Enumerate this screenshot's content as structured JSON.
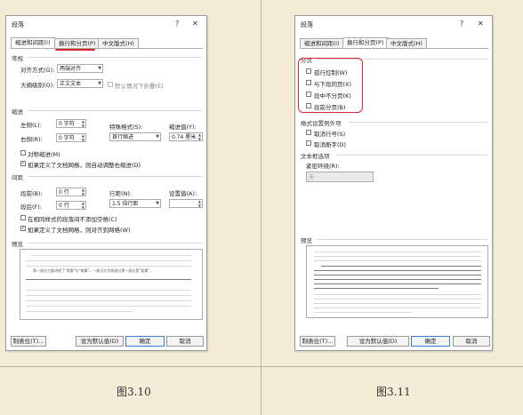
{
  "dialog_left": {
    "title": "段落",
    "help_glyph": "?",
    "close_glyph": "✕",
    "tabs": [
      "缩进和间距(I)",
      "换行和分页(P)",
      "中文版式(H)"
    ],
    "general": {
      "heading": "常规",
      "alignment_label": "对齐方式(G):",
      "alignment_value": "两端对齐",
      "outline_label": "大纲级别(O):",
      "outline_value": "正文文本",
      "collapse_label": "默认情况下折叠(E)"
    },
    "indent": {
      "heading": "缩进",
      "left_label": "左侧(L):",
      "left_value": "0 字符",
      "right_label": "右侧(R):",
      "right_value": "0 字符",
      "special_label": "特殊格式(S):",
      "special_value": "首行缩进",
      "by_label": "缩进值(Y):",
      "by_value": "0.74 厘米",
      "mirror_label": "对称缩进(M)",
      "auto_adjust_label": "如果定义了文档网格，则自动调整右缩进(D)"
    },
    "spacing": {
      "heading": "间距",
      "before_label": "段前(B):",
      "before_value": "0 行",
      "after_label": "段后(F):",
      "after_value": "0 行",
      "line_label": "行距(N):",
      "line_value": "1.5 倍行距",
      "at_label": "设置值(A):",
      "no_space_label": "在相同样式的段落间不添加空格(C)",
      "snap_label": "如果定义了文档网格，则对齐到网格(W)"
    },
    "preview_heading": "预览",
    "preview_sample": "第一部分主要讲述了\"背景\"与\"故事\"，一般可分为两部分第一部分是\"背景\"...",
    "buttons": {
      "tabs": "制表位(T)...",
      "set_default": "设为默认值(D)",
      "ok": "确定",
      "cancel": "取消"
    }
  },
  "dialog_right": {
    "title": "段落",
    "help_glyph": "?",
    "close_glyph": "✕",
    "tabs": [
      "缩进和间距(I)",
      "换行和分页(P)",
      "中文版式(H)"
    ],
    "pagination": {
      "heading": "分页",
      "widow_label": "孤行控制(W)",
      "keep_next_label": "与下段同页(X)",
      "keep_lines_label": "段中不分页(K)",
      "page_break_label": "段前分页(B)"
    },
    "formatting_exceptions": {
      "heading": "格式设置例外项",
      "suppress_line_numbers_label": "取消行号(S)",
      "no_hyphenate_label": "取消断字(D)"
    },
    "textbox": {
      "heading": "文本框选项",
      "tight_wrap_label": "紧密环绕(R):",
      "tight_wrap_value": "无"
    },
    "preview_heading": "预览",
    "buttons": {
      "tabs": "制表位(T)...",
      "set_default": "设为默认值(D)",
      "ok": "确定",
      "cancel": "取消"
    }
  },
  "captions": {
    "left": "图3.10",
    "right": "图3.11"
  },
  "colors": {
    "annotation": "#d8262d",
    "background": "#f4ecd6"
  }
}
